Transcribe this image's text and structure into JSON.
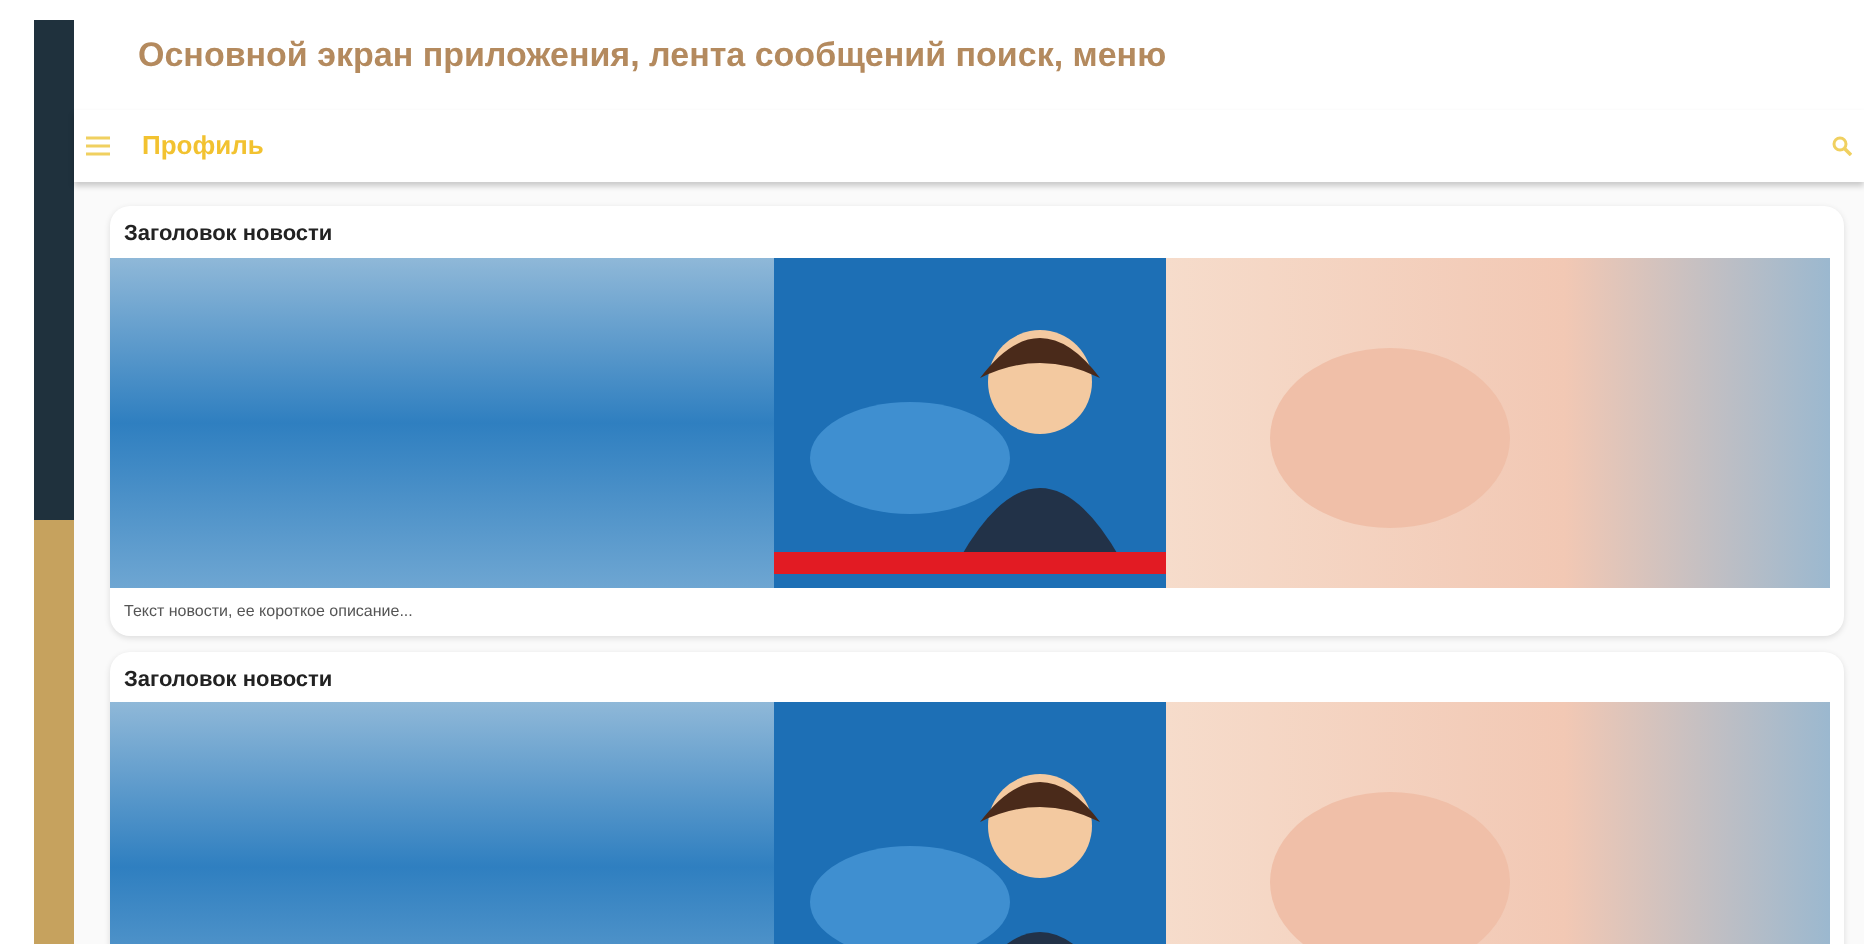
{
  "page_title": "Основной экран приложения, лента сообщений поиск, меню",
  "app_bar": {
    "title": "Профиль"
  },
  "feed": [
    {
      "title": "Заголовок новости",
      "description": "Текст новости, ее короткое описание..."
    },
    {
      "title": "Заголовок новости"
    }
  ]
}
